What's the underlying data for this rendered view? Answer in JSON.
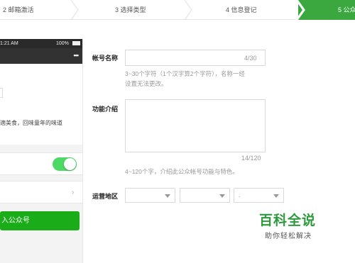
{
  "steps": [
    {
      "label": "2 邮箱激活"
    },
    {
      "label": "3 选择类型"
    },
    {
      "label": "4 信息登记"
    },
    {
      "label": "5 公众"
    }
  ],
  "phone": {
    "time": "1:21 AM",
    "battery": "100%",
    "menu": "•••",
    "description": "適美食，回味童年的味道",
    "chevron": "›",
    "follow_button": "入公众号"
  },
  "form": {
    "account_name": {
      "label": "帐号名称",
      "value": "",
      "counter": "4/30",
      "hint_line1": "3~30个字符（1个汉字算2个字符），名称一经",
      "hint_line2": "设置无法更改。"
    },
    "intro": {
      "label": "功能介绍",
      "value": "",
      "counter": "14/120",
      "hint": "4~120个字，介绍此公众帐号功能与特色。"
    },
    "region": {
      "label": "运营地区",
      "selects": [
        "",
        "",
        "."
      ]
    }
  },
  "watermark": {
    "title": "百科全说",
    "subtitle": "助你轻松解决"
  },
  "colors": {
    "active_step": "#3ba83f",
    "follow_button": "#1aad19",
    "toggle_on": "#4cd964",
    "watermark": "#2e9a3c"
  }
}
